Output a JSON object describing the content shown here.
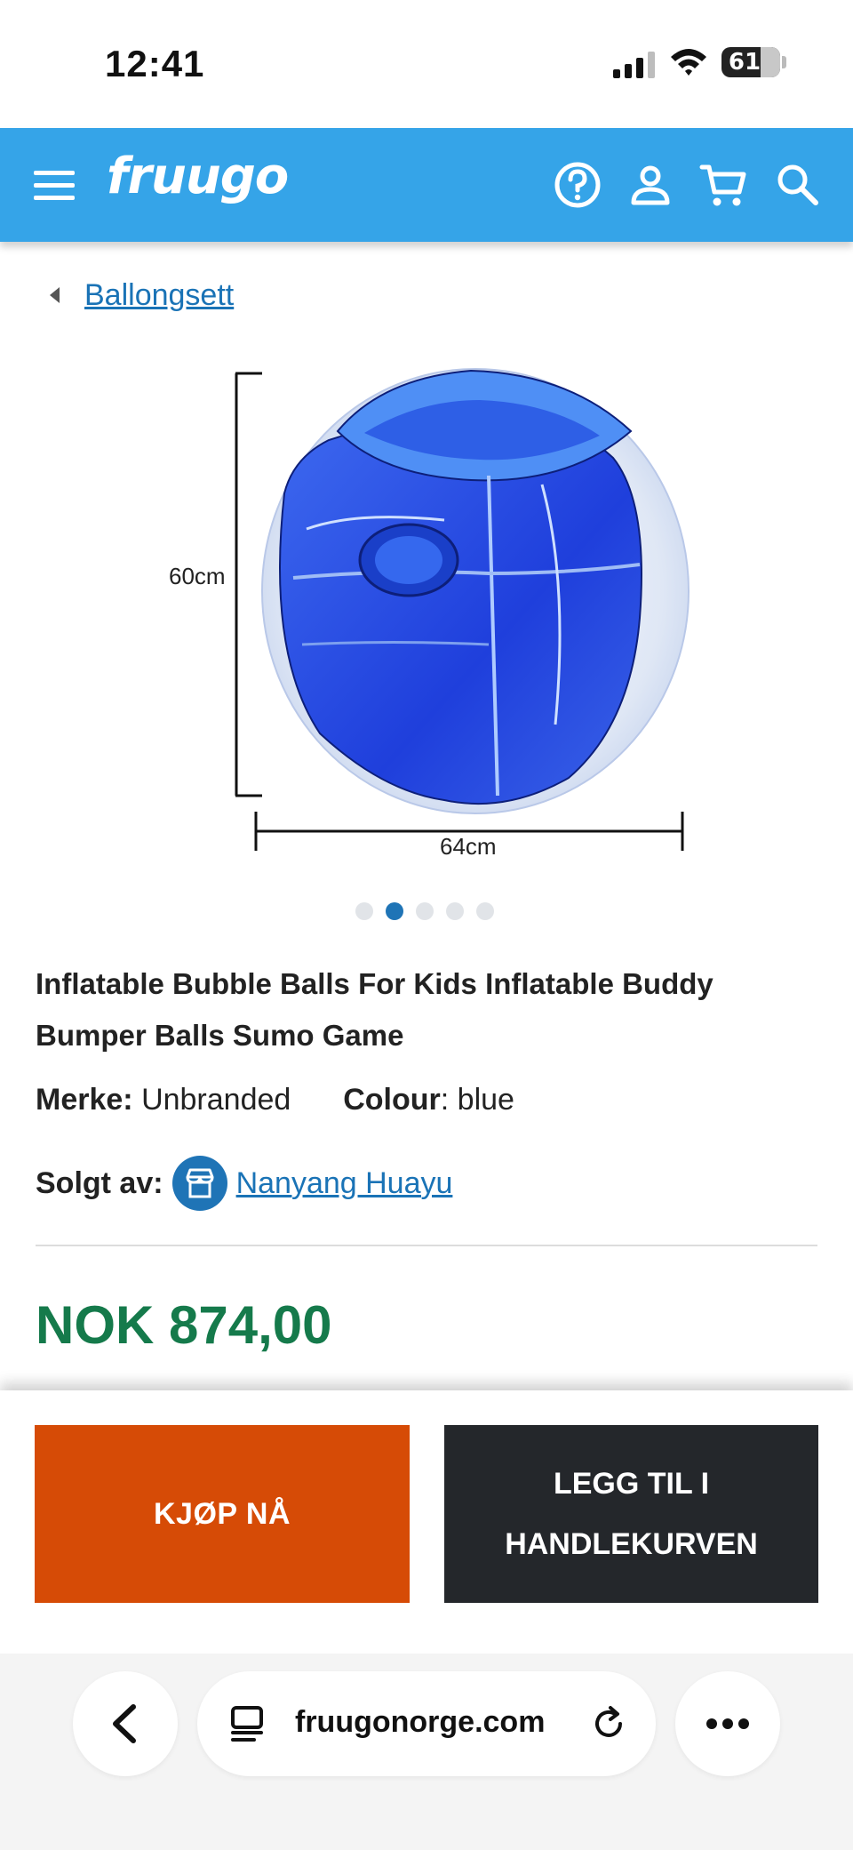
{
  "status_bar": {
    "time": "12:41",
    "battery": "61",
    "icons": [
      "signal-icon",
      "wifi-icon",
      "battery-icon"
    ]
  },
  "header": {
    "logo": "fruugo",
    "background_color": "#35a4e8",
    "icons": [
      "menu-icon",
      "help-icon",
      "account-icon",
      "cart-icon",
      "search-icon"
    ]
  },
  "breadcrumb": {
    "label": "Ballongsett"
  },
  "product_image": {
    "height_label": "60cm",
    "width_label": "64cm"
  },
  "carousel": {
    "count": 5,
    "active_index": 1
  },
  "product": {
    "title": "Inflatable Bubble Balls For Kids Inflatable Buddy Bumper Balls Sumo Game",
    "brand_label": "Merke:",
    "brand_value": "Unbranded",
    "colour_label": "Colour",
    "colour_value": "blue",
    "seller_label": "Solgt av:",
    "seller_name": "Nanyang Huayu",
    "price": "NOK 874,00",
    "price_color": "#157a4b"
  },
  "actions": {
    "buy_now": "KJØP NÅ",
    "add_to_cart": "LEGG TIL I HANDLEKURVEN",
    "buy_color": "#d64b06",
    "cart_color": "#24272b"
  },
  "browser": {
    "url": "fruugonorge.com"
  }
}
